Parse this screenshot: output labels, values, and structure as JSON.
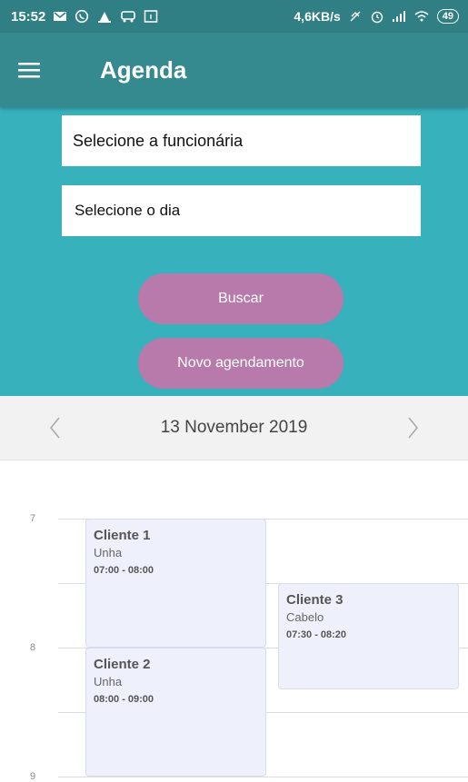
{
  "status_bar": {
    "time": "15:52",
    "net_speed": "4,6KB/s",
    "battery": "49",
    "icons": [
      "mail-icon",
      "whatsapp-icon",
      "app-icon",
      "car-icon",
      "calendar-icon",
      "no-sync-icon",
      "alarm-icon",
      "signal-icon",
      "wifi-icon",
      "battery-icon"
    ]
  },
  "app_bar": {
    "title": "Agenda",
    "menu_icon": "hamburger-menu-icon"
  },
  "form": {
    "employee_select": "Selecione a funcionária",
    "day_select": "Selecione o dia",
    "search_button": "Buscar",
    "new_appointment_button": "Novo agendamento"
  },
  "date_header": {
    "date": "13 November 2019",
    "prev_icon": "chevron-left-icon",
    "next_icon": "chevron-right-icon"
  },
  "timeline": {
    "hours": [
      "7",
      "8",
      "9"
    ],
    "events": [
      {
        "client": "Cliente 1",
        "service": "Unha",
        "time": "07:00 - 08:00"
      },
      {
        "client": "Cliente 3",
        "service": "Cabelo",
        "time": "07:30 - 08:20"
      },
      {
        "client": "Cliente 2",
        "service": "Unha",
        "time": "08:00 - 09:00"
      }
    ]
  },
  "colors": {
    "status_bar": "#2f7f84",
    "app_bar": "#358a90",
    "form_background": "#37b1bc",
    "button": "#b879ab",
    "event_background": "#eef1fc"
  }
}
